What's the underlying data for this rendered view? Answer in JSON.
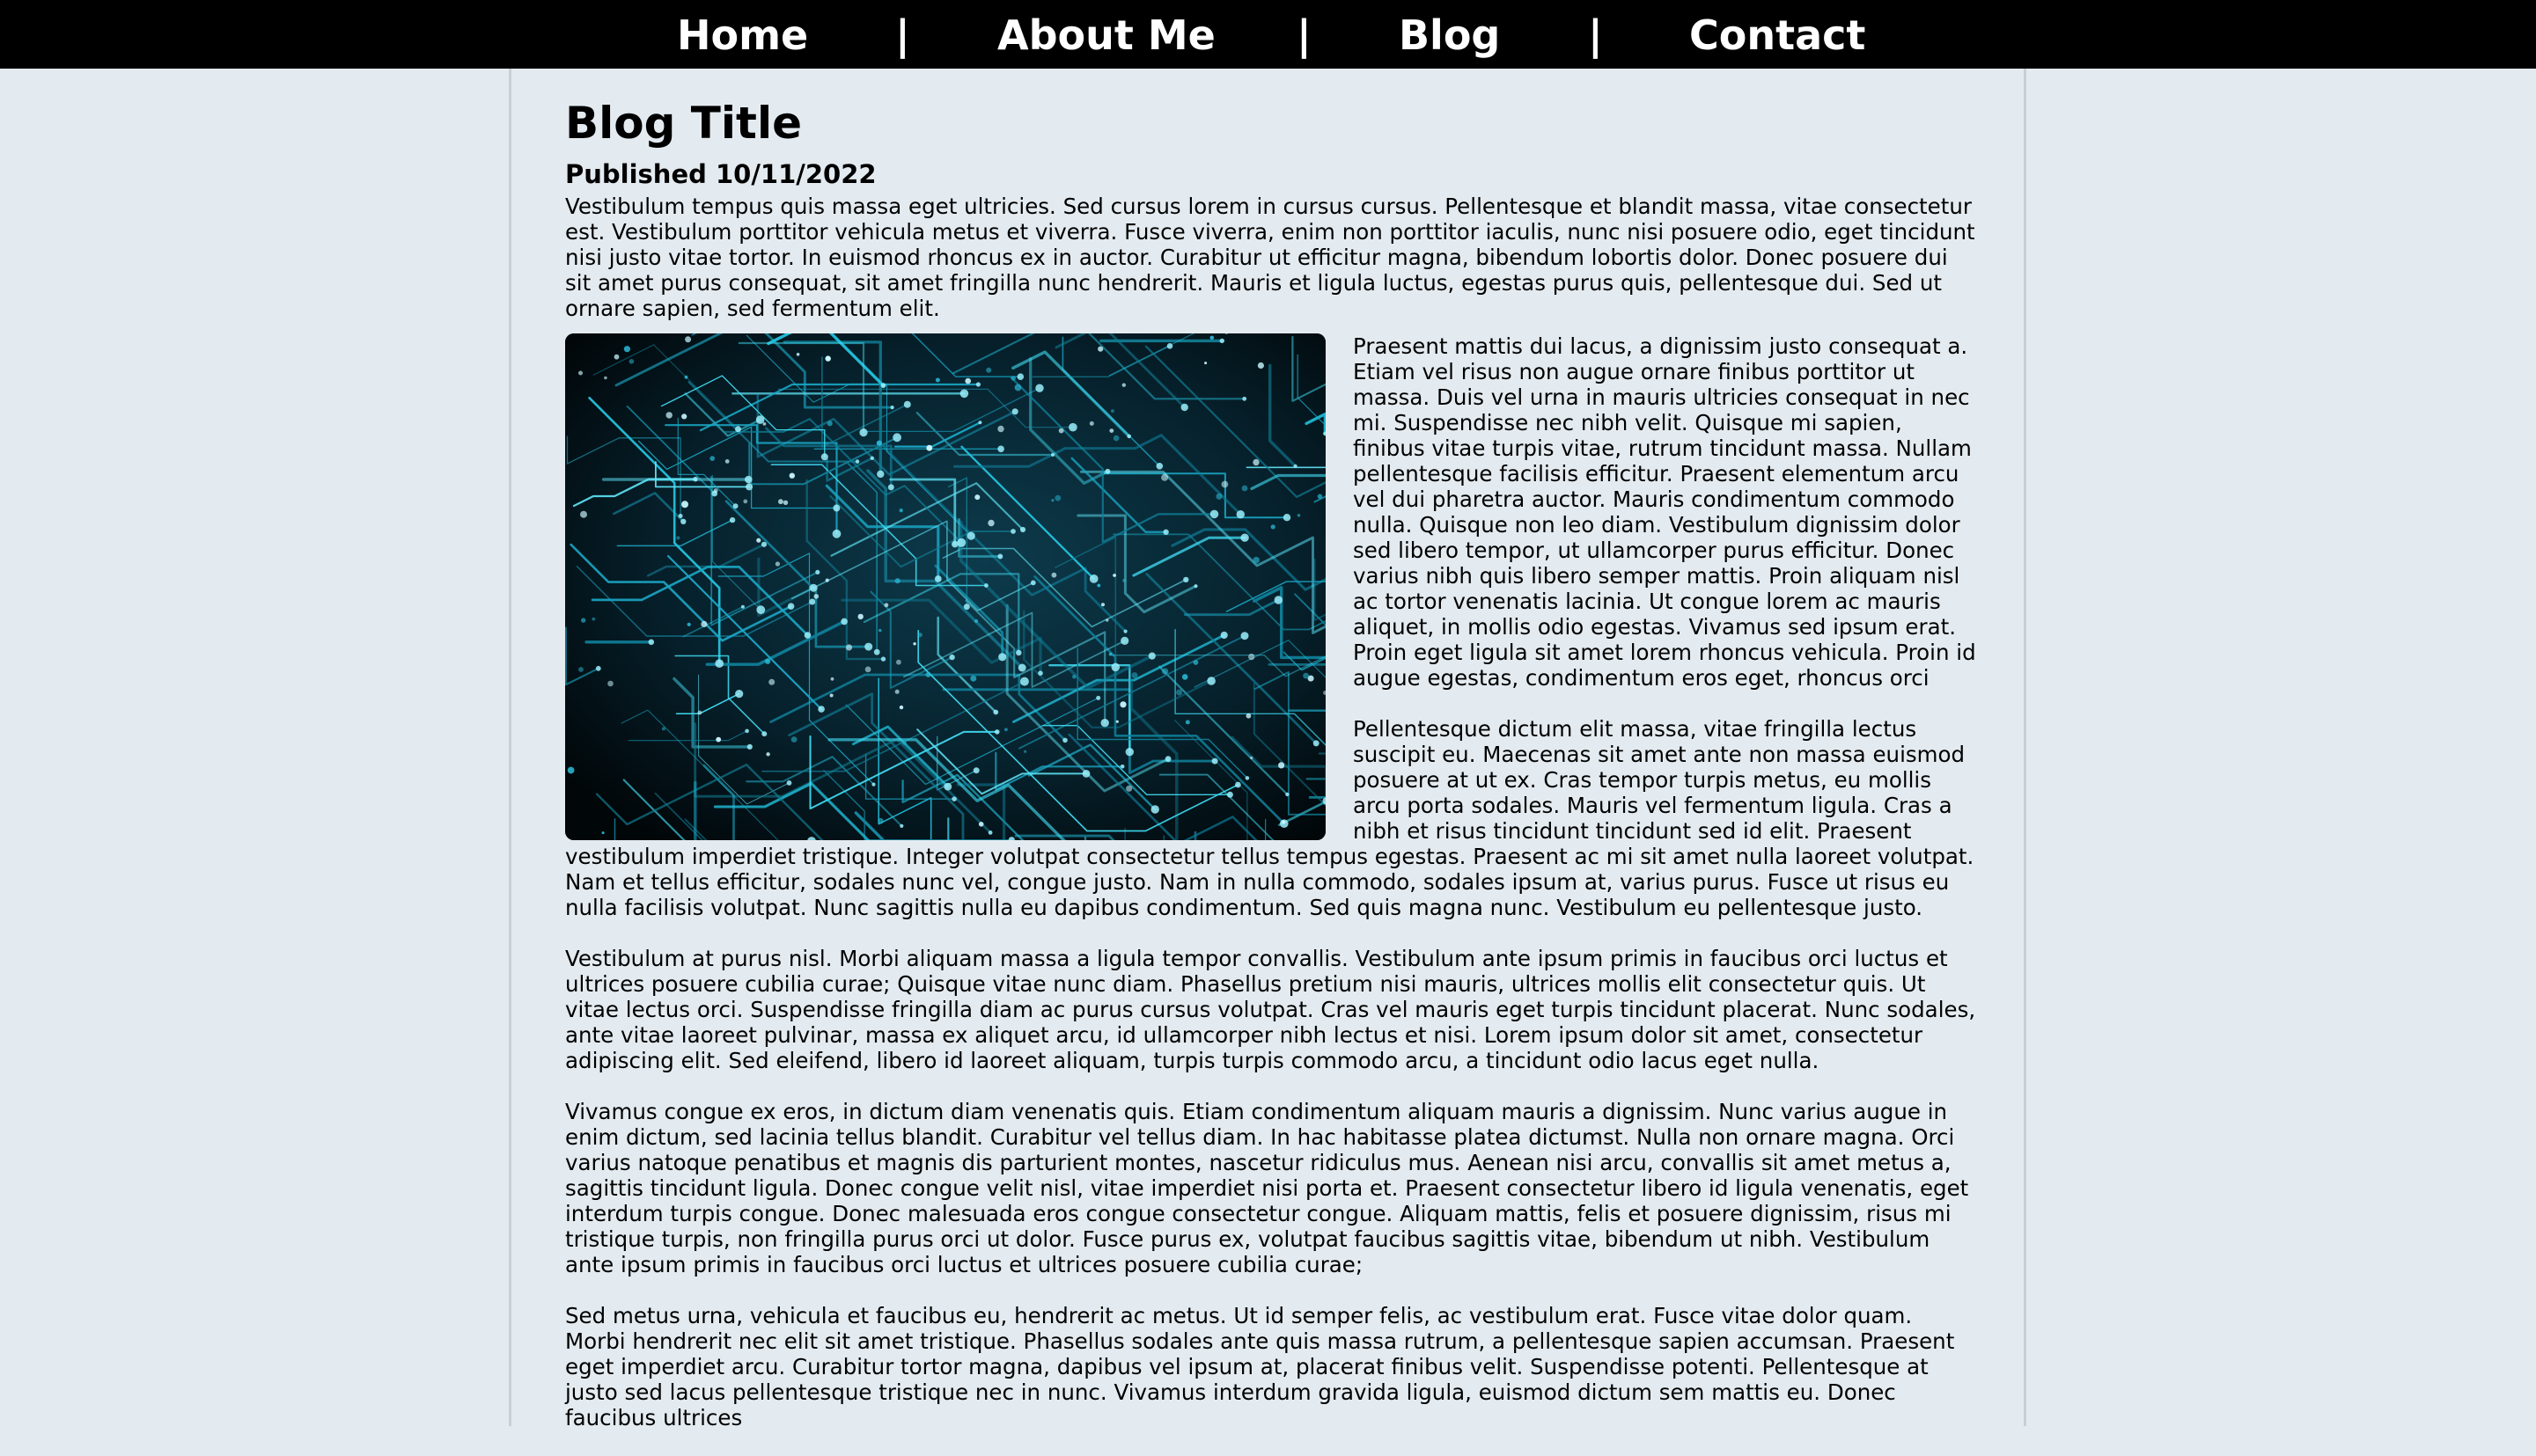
{
  "nav": {
    "items": [
      {
        "label": "Home"
      },
      {
        "label": "About Me"
      },
      {
        "label": "Blog"
      },
      {
        "label": "Contact"
      }
    ],
    "separator": "|"
  },
  "post": {
    "title": "Blog Title",
    "published": "Published 10/11/2022",
    "image_icon": "circuit-board-image",
    "paragraphs": [
      "Vestibulum tempus quis massa eget ultricies. Sed cursus lorem in cursus cursus. Pellentesque et blandit massa, vitae consectetur est. Vestibulum porttitor vehicula metus et viverra. Fusce viverra, enim non porttitor iaculis, nunc nisi posuere odio, eget tincidunt nisi justo vitae tortor. In euismod rhoncus ex in auctor. Curabitur ut efficitur magna, bibendum lobortis dolor. Donec posuere dui sit amet purus consequat, sit amet fringilla nunc hendrerit. Mauris et ligula luctus, egestas purus quis, pellentesque dui. Sed ut ornare sapien, sed fermentum elit.",
      "Praesent mattis dui lacus, a dignissim justo consequat a. Etiam vel risus non augue ornare finibus porttitor ut massa. Duis vel urna in mauris ultricies consequat in nec mi. Suspendisse nec nibh velit. Quisque mi sapien, finibus vitae turpis vitae, rutrum tincidunt massa. Nullam pellentesque facilisis efficitur. Praesent elementum arcu vel dui pharetra auctor. Mauris condimentum commodo nulla. Quisque non leo diam. Vestibulum dignissim dolor sed libero tempor, ut ullamcorper purus efficitur. Donec varius nibh quis libero semper mattis. Proin aliquam nisl ac tortor venenatis lacinia. Ut congue lorem ac mauris aliquet, in mollis odio egestas. Vivamus sed ipsum erat. Proin eget ligula sit amet lorem rhoncus vehicula. Proin id augue egestas, condimentum eros eget, rhoncus orci",
      "Pellentesque dictum elit massa, vitae fringilla lectus suscipit eu. Maecenas sit amet ante non massa euismod posuere at ut ex. Cras tempor turpis metus, eu mollis arcu porta sodales. Mauris vel fermentum ligula. Cras a nibh et risus tincidunt tincidunt sed id elit. Praesent vestibulum imperdiet tristique. Integer volutpat consectetur tellus tempus egestas. Praesent ac mi sit amet nulla laoreet volutpat. Nam et tellus efficitur, sodales nunc vel, congue justo. Nam in nulla commodo, sodales ipsum at, varius purus. Fusce ut risus eu nulla facilisis volutpat. Nunc sagittis nulla eu dapibus condimentum. Sed quis magna nunc. Vestibulum eu pellentesque justo.",
      "Vestibulum at purus nisl. Morbi aliquam massa a ligula tempor convallis. Vestibulum ante ipsum primis in faucibus orci luctus et ultrices posuere cubilia curae; Quisque vitae nunc diam. Phasellus pretium nisi mauris, ultrices mollis elit consectetur quis. Ut vitae lectus orci. Suspendisse fringilla diam ac purus cursus volutpat. Cras vel mauris eget turpis tincidunt placerat. Nunc sodales, ante vitae laoreet pulvinar, massa ex aliquet arcu, id ullamcorper nibh lectus et nisi. Lorem ipsum dolor sit amet, consectetur adipiscing elit. Sed eleifend, libero id laoreet aliquam, turpis turpis commodo arcu, a tincidunt odio lacus eget nulla.",
      "Vivamus congue ex eros, in dictum diam venenatis quis. Etiam condimentum aliquam mauris a dignissim. Nunc varius augue in enim dictum, sed lacinia tellus blandit. Curabitur vel tellus diam. In hac habitasse platea dictumst. Nulla non ornare magna. Orci varius natoque penatibus et magnis dis parturient montes, nascetur ridiculus mus. Aenean nisi arcu, convallis sit amet metus a, sagittis tincidunt ligula. Donec congue velit nisl, vitae imperdiet nisi porta et. Praesent consectetur libero id ligula venenatis, eget interdum turpis congue. Donec malesuada eros congue consectetur congue. Aliquam mattis, felis et posuere dignissim, risus mi tristique turpis, non fringilla purus orci ut dolor. Fusce purus ex, volutpat faucibus sagittis vitae, bibendum ut nibh. Vestibulum ante ipsum primis in faucibus orci luctus et ultrices posuere cubilia curae;",
      "Sed metus urna, vehicula et faucibus eu, hendrerit ac metus. Ut id semper felis, ac vestibulum erat. Fusce vitae dolor quam. Morbi hendrerit nec elit sit amet tristique. Phasellus sodales ante quis massa rutrum, a pellentesque sapien accumsan. Praesent eget imperdiet arcu. Curabitur tortor magna, dapibus vel ipsum at, placerat finibus velit. Suspendisse potenti. Pellentesque at justo sed lacus pellentesque tristique nec in nunc. Vivamus interdum gravida ligula, euismod dictum sem mattis eu. Donec faucibus ultrices"
    ]
  }
}
